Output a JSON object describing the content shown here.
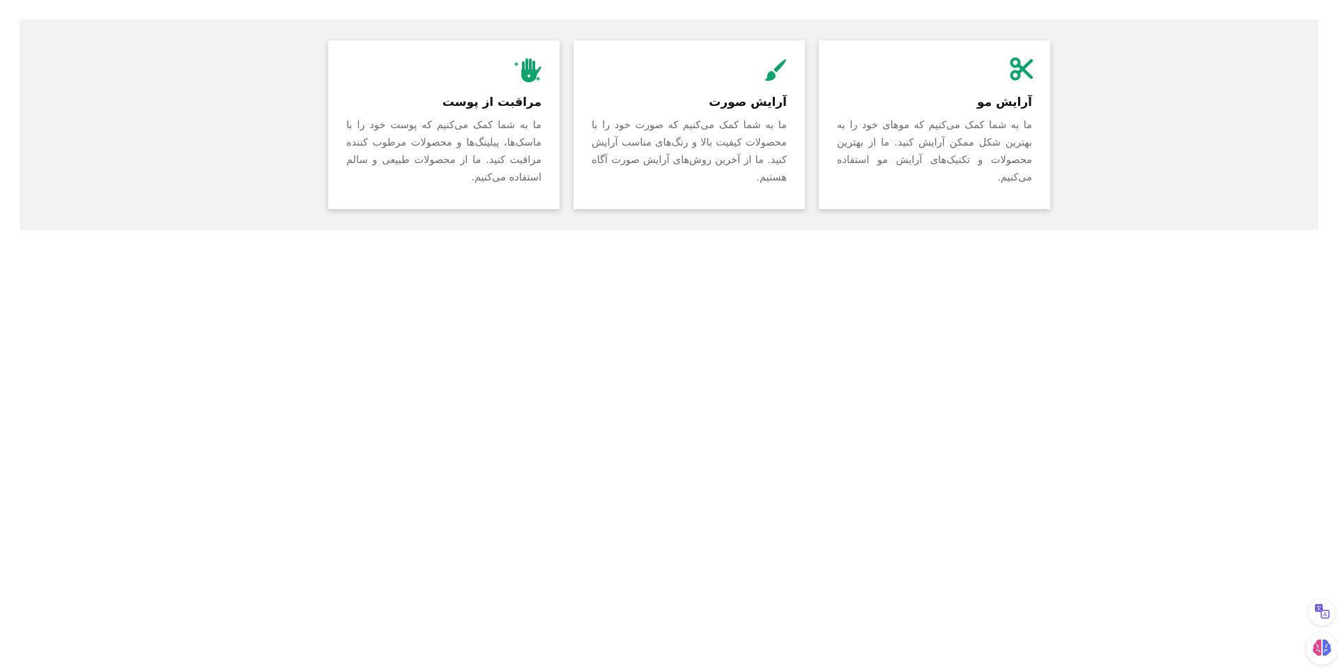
{
  "colors": {
    "accent": "#0fa36b",
    "section_bg": "#f2f2f2",
    "card_bg": "#ffffff",
    "title": "#111111",
    "text": "#6b6b6b"
  },
  "cards": [
    {
      "icon": "scissors-icon",
      "title": "آرایش مو",
      "text": "ما به شما کمک می‌کنیم که موهای خود را به بهترین شکل ممکن آرایش کنید. ما از بهترین محصولات و تکنیک‌های آرایش مو استفاده می‌کنیم."
    },
    {
      "icon": "brush-icon",
      "title": "آرایش صورت",
      "text": "ما به شما کمک می‌کنیم که صورت خود را با محصولات کیفیت بالا و رنگ‌های مناسب آرایش کنید. ما از آخرین روش‌های آرایش صورت آگاه هستیم."
    },
    {
      "icon": "hand-sparkles-icon",
      "title": "مراقبت از پوست",
      "text": "ما به شما کمک می‌کنیم که پوست خود را با ماسک‌ها، پیلینگ‌ها و محصولات مرطوب کننده مراقبت کنید. ما از محصولات طبیعی و سالم استفاده می‌کنیم."
    }
  ],
  "floating": {
    "translate_icon": "translate-icon",
    "brain_icon": "brain-icon"
  }
}
